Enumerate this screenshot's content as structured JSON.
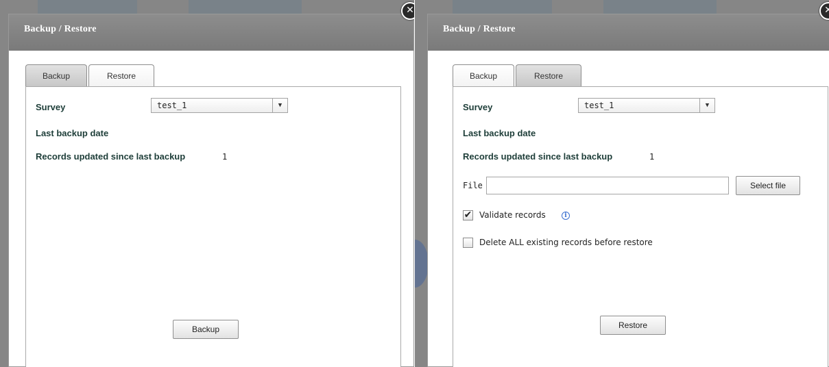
{
  "left": {
    "title": "Backup / Restore",
    "tabs": [
      {
        "label": "Backup",
        "active": true
      },
      {
        "label": "Restore",
        "active": false
      }
    ],
    "survey_label": "Survey",
    "survey_value": "test_1",
    "last_backup_label": "Last backup date",
    "records_label": "Records updated since last backup",
    "records_count": "1",
    "action_button": "Backup"
  },
  "right": {
    "title": "Backup / Restore",
    "tabs": [
      {
        "label": "Backup",
        "active": false
      },
      {
        "label": "Restore",
        "active": true
      }
    ],
    "survey_label": "Survey",
    "survey_value": "test_1",
    "last_backup_label": "Last backup date",
    "records_label": "Records updated since last backup",
    "records_count": "1",
    "file_label": "File",
    "file_value": "",
    "select_file_button": "Select file",
    "validate_label": "Validate records",
    "validate_checked": true,
    "delete_label": "Delete ALL existing records before restore",
    "delete_checked": false,
    "action_button": "Restore"
  },
  "icons": {
    "close": "close-icon",
    "dropdown": "chevron-down-icon",
    "info": "info-icon",
    "check": "checkmark-icon"
  },
  "colors": {
    "titlebar": "#808080",
    "label_text": "#1d3d38",
    "info_blue": "#3a6fd0"
  }
}
